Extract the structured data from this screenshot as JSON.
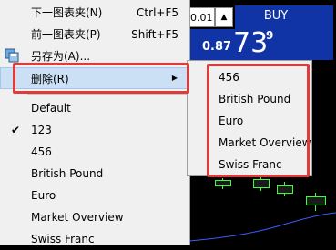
{
  "background": {
    "price_input": "0.01",
    "buy_label": "BUY",
    "price_small": "0.87",
    "price_big": "73",
    "price_sup": "9"
  },
  "menu": {
    "items": [
      {
        "label": "下一图表夹(N)",
        "shortcut": "Ctrl+F5"
      },
      {
        "label": "前一图表夹(P)",
        "shortcut": "Shift+F5"
      },
      {
        "label": "另存为(A)..."
      },
      {
        "label": "删除(R)"
      },
      {
        "label": "Default"
      },
      {
        "label": "123"
      },
      {
        "label": "456"
      },
      {
        "label": "British Pound"
      },
      {
        "label": "Euro"
      },
      {
        "label": "Market Overview"
      },
      {
        "label": "Swiss Franc"
      }
    ],
    "checked_item": "123"
  },
  "submenu": {
    "items": [
      "456",
      "British Pound",
      "Euro",
      "Market Overview",
      "Swiss Franc"
    ]
  },
  "colors": {
    "highlight": "#e03b3b",
    "selected": "#cce0f5",
    "buy_panel": "#1034a6"
  }
}
